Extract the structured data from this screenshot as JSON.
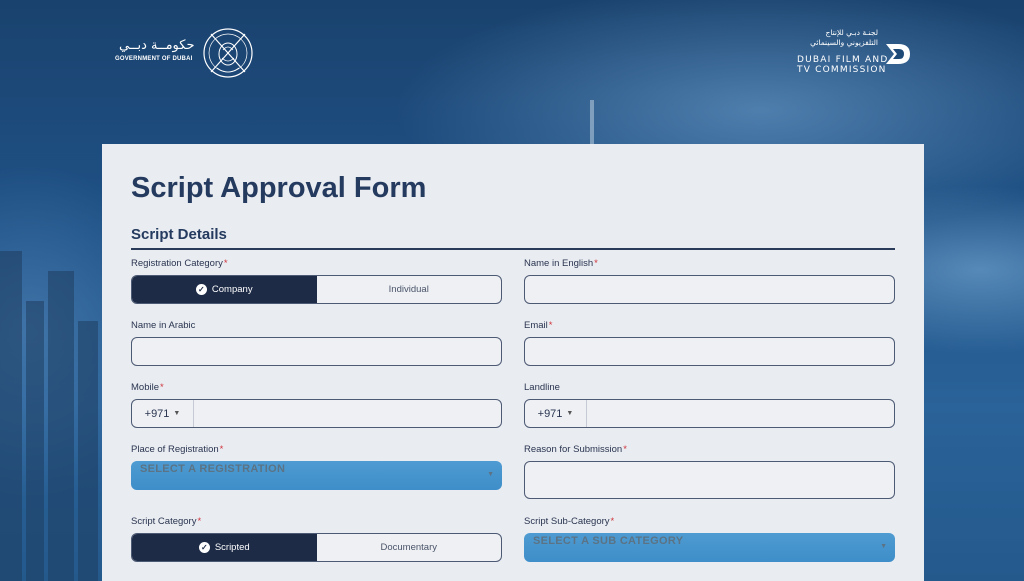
{
  "header": {
    "gov_logo_arabic": "حكومــة دبــي",
    "gov_logo_english": "GOVERNMENT OF DUBAI",
    "dfc_logo_arabic_line1": "لجنـة دبـي للإنتاج",
    "dfc_logo_arabic_line2": "التلفزيوني والسينمائي",
    "dfc_logo_english_line1": "DUBAI FILM AND",
    "dfc_logo_english_line2": "TV COMMISSION"
  },
  "form": {
    "title": "Script Approval Form",
    "section": "Script Details",
    "required_mark": "*",
    "registration_category": {
      "label": "Registration Category",
      "options": [
        "Company",
        "Individual"
      ],
      "selected": "Company"
    },
    "name_english": {
      "label": "Name in English",
      "value": ""
    },
    "name_arabic": {
      "label": "Name in Arabic",
      "value": ""
    },
    "email": {
      "label": "Email",
      "value": ""
    },
    "mobile": {
      "label": "Mobile",
      "country_code": "+971",
      "value": ""
    },
    "landline": {
      "label": "Landline",
      "country_code": "+971",
      "value": ""
    },
    "place_of_registration": {
      "label": "Place of Registration",
      "placeholder": "SELECT A REGISTRATION"
    },
    "reason": {
      "label": "Reason for Submission",
      "value": ""
    },
    "script_category": {
      "label": "Script Category",
      "options": [
        "Scripted",
        "Documentary"
      ],
      "selected": "Scripted"
    },
    "script_sub_category": {
      "label": "Script Sub-Category",
      "placeholder": "SELECT A SUB CATEGORY"
    }
  },
  "colors": {
    "accent_dark": "#1d2b47",
    "select_blue": "#4f9bd2",
    "required_red": "#d0343b",
    "background_blue": "#1e4a78"
  }
}
